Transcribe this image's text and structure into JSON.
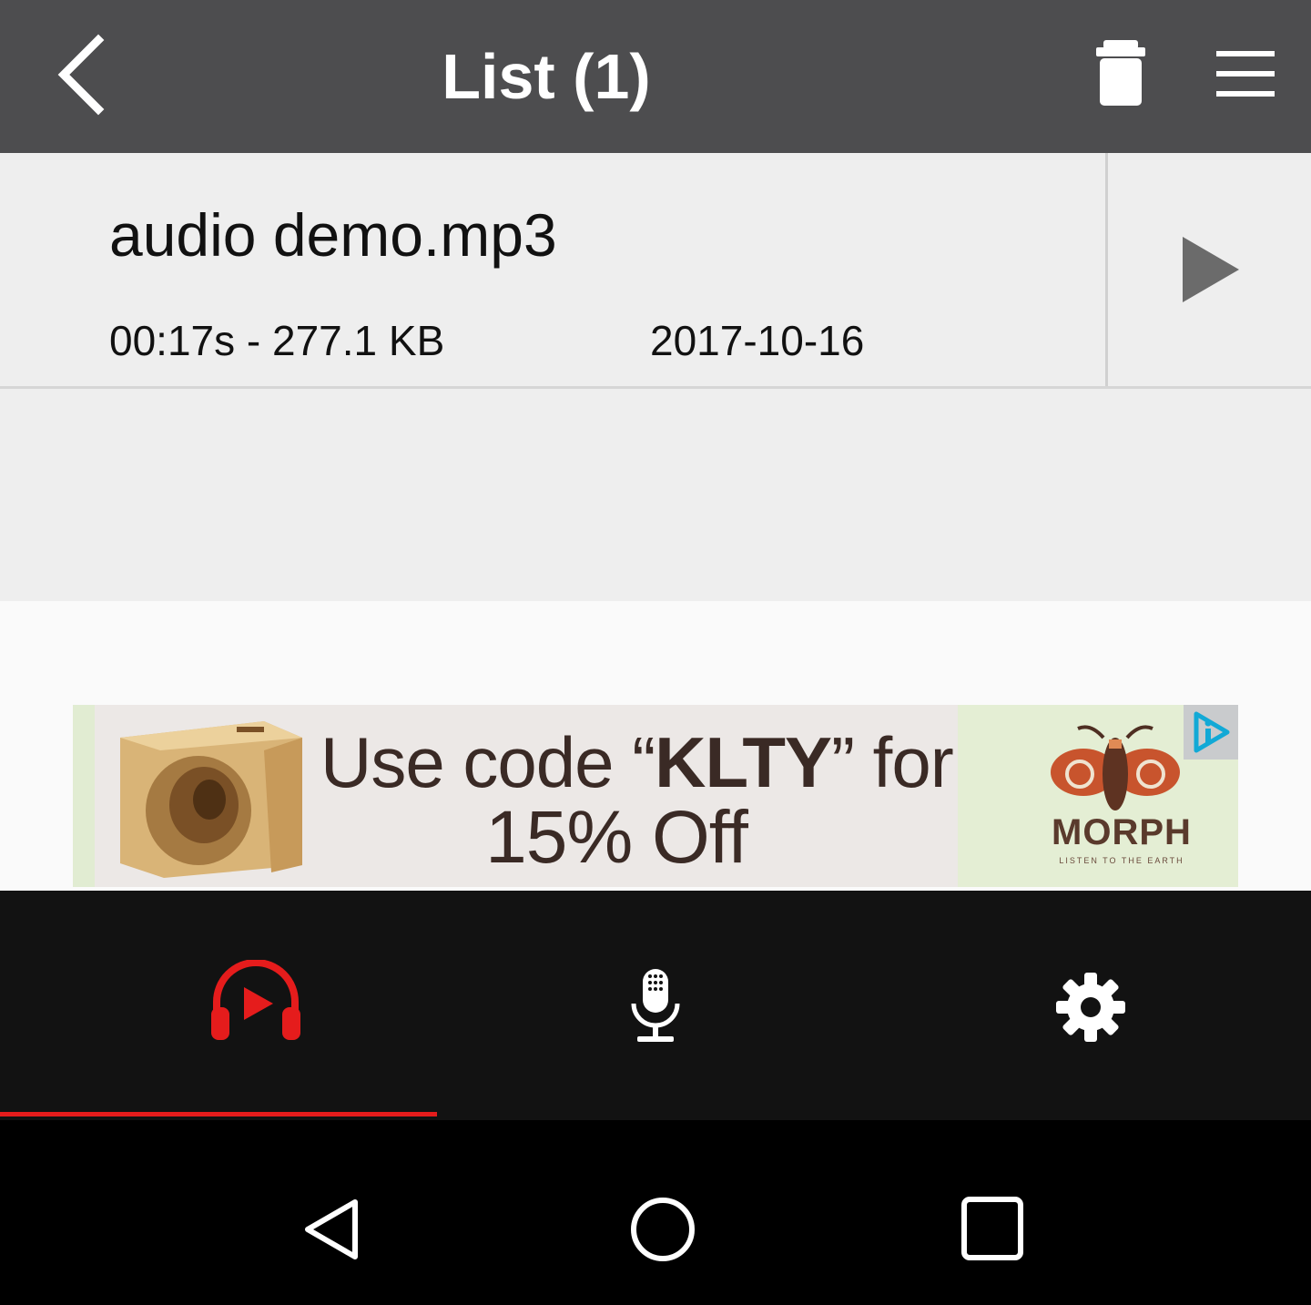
{
  "header": {
    "title": "List (1)",
    "back_icon": "chevron-left-icon",
    "delete_icon": "trash-icon",
    "menu_icon": "hamburger-menu-icon"
  },
  "recordings": [
    {
      "filename": "audio demo.mp3",
      "meta": "00:17s - 277.1 KB",
      "date": "2017-10-16",
      "action_icon": "play-icon"
    }
  ],
  "ad": {
    "line1_prefix": "Use code “",
    "line1_code": "KLTY",
    "line1_suffix": "” for",
    "line2": "15% Off",
    "brand": "MORPH",
    "tagline": "LISTEN TO THE EARTH",
    "adchoices_icon": "adchoices-icon"
  },
  "tabs": [
    {
      "name": "player",
      "icon": "headphones-play-icon",
      "active": true
    },
    {
      "name": "record",
      "icon": "microphone-icon",
      "active": false
    },
    {
      "name": "settings",
      "icon": "gear-icon",
      "active": false
    }
  ],
  "colors": {
    "header_bg": "#4d4d4f",
    "list_bg": "#eeeeee",
    "tabbar_bg": "#121212",
    "accent": "#e51c1c"
  },
  "system_nav": {
    "back_icon": "nav-back-icon",
    "home_icon": "nav-home-icon",
    "recents_icon": "nav-recents-icon"
  }
}
